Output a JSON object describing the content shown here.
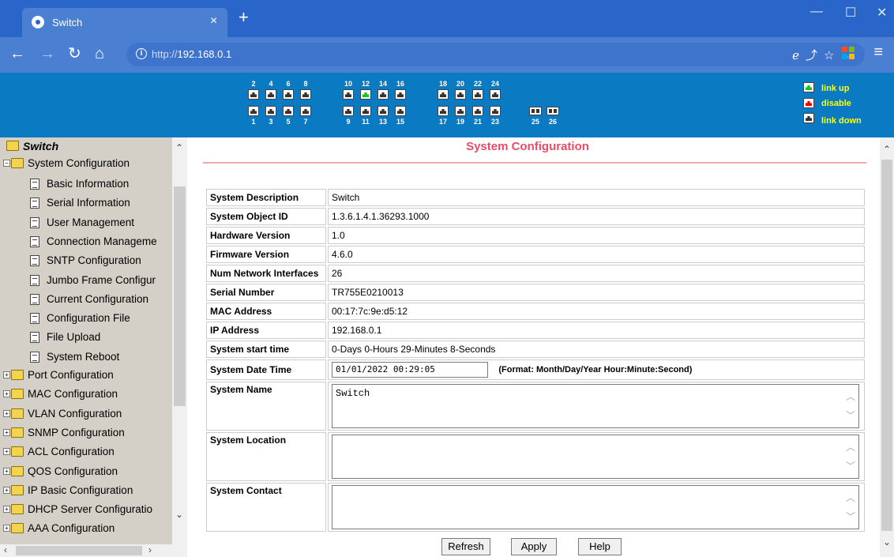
{
  "browser": {
    "tab_title": "Switch",
    "tab_close": "×",
    "new_tab": "+",
    "url_prefix": "http://",
    "url_host": "192.168.0.1",
    "window_minimize": "—",
    "window_maximize": "☐",
    "window_close": "✕"
  },
  "ports": {
    "top_numbers": [
      "2",
      "4",
      "6",
      "8",
      "10",
      "12",
      "14",
      "16",
      "18",
      "20",
      "22",
      "24"
    ],
    "bottom_numbers": [
      "1",
      "3",
      "5",
      "7",
      "9",
      "11",
      "13",
      "15",
      "17",
      "19",
      "21",
      "23"
    ],
    "fiber_numbers": [
      "25",
      "26"
    ],
    "link_up_port": "12",
    "status_colors": {
      "link_up": "#18c41a",
      "disable": "#ee0000",
      "link_down": "#333333"
    },
    "legend": {
      "link_up": "link up",
      "disable": "disable",
      "link_down": "link down"
    }
  },
  "tree": {
    "root": "Switch",
    "open_folder": "System Configuration",
    "leaves": [
      "Basic Information",
      "Serial Information",
      "User Management",
      "Connection Manageme",
      "SNTP Configuration",
      "Jumbo Frame Configur",
      "Current Configuration",
      "Configuration File",
      "File Upload",
      "System Reboot"
    ],
    "folders": [
      "Port Configuration",
      "MAC Configuration",
      "VLAN Configuration",
      "SNMP Configuration",
      "ACL Configuration",
      "QOS Configuration",
      "IP Basic Configuration",
      "DHCP Server Configuratio",
      "AAA Configuration"
    ]
  },
  "page": {
    "title": "System Configuration",
    "rows": [
      {
        "label": "System Description",
        "value": "Switch"
      },
      {
        "label": "System Object ID",
        "value": "1.3.6.1.4.1.36293.1000"
      },
      {
        "label": "Hardware Version",
        "value": "1.0"
      },
      {
        "label": "Firmware Version",
        "value": "4.6.0"
      },
      {
        "label": "Num Network Interfaces",
        "value": "26"
      },
      {
        "label": "Serial Number",
        "value": "TR755E0210013"
      },
      {
        "label": "MAC Address",
        "value": "00:17:7c:9e:d5:12"
      },
      {
        "label": "IP Address",
        "value": "192.168.0.1"
      },
      {
        "label": "System start time",
        "value": "0-Days 0-Hours 29-Minutes 8-Seconds"
      }
    ],
    "date_label": "System Date Time",
    "date_value": "01/01/2022 00:29:05",
    "date_hint": "(Format: Month/Day/Year Hour:Minute:Second)",
    "name_label": "System Name",
    "name_value": "Switch",
    "location_label": "System Location",
    "location_value": "",
    "contact_label": "System Contact",
    "contact_value": "",
    "buttons": {
      "refresh": "Refresh",
      "apply": "Apply",
      "help": "Help"
    }
  }
}
